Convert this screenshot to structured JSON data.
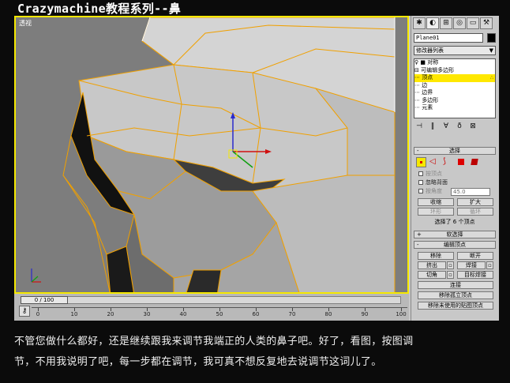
{
  "banner": {
    "title": "Crazymachine教程系列--鼻"
  },
  "viewport": {
    "label": "透视"
  },
  "timeline": {
    "slider_text": "0 / 100",
    "key_icon": "key-icon",
    "ticks": [
      "0",
      "10",
      "20",
      "30",
      "40",
      "50",
      "60",
      "70",
      "80",
      "90",
      "100"
    ]
  },
  "panel": {
    "tabs": [
      "create-icon",
      "modify-icon",
      "hierarchy-icon",
      "motion-icon",
      "display-icon",
      "utilities-icon"
    ],
    "object_name": "Plane01",
    "object_color": "#000000",
    "modifier_list": "修改器列表",
    "stack": {
      "items": [
        {
          "label": "♀ ■ 对称",
          "selected": false
        },
        {
          "label": "⊟ 可编辑多边形",
          "selected": false
        },
        {
          "label": "   ⋯ 顶点",
          "selected": true
        },
        {
          "label": "      ⋯ 边",
          "selected": false
        },
        {
          "label": "      ⋯ 边界",
          "selected": false
        },
        {
          "label": "      ⋯ 多边形",
          "selected": false
        },
        {
          "label": "      ⋯ 元素",
          "selected": false
        }
      ]
    },
    "selection": {
      "title": "选择",
      "by_vertex": "按顶点",
      "ignore_backfacing": "忽略背面",
      "by_angle": "按角度",
      "angle_value": "45.0",
      "shrink": "收缩",
      "grow": "扩大",
      "ring": "环形",
      "loop": "循环",
      "status": "选择了 6 个顶点"
    },
    "soft_selection": {
      "title": "软选择"
    },
    "edit_vertices": {
      "title": "编辑顶点",
      "remove": "移除",
      "break": "断开",
      "extrude": "挤出",
      "weld": "焊接",
      "chamfer": "切角",
      "target_weld": "目标焊接",
      "connect": "连接",
      "remove_isolated": "移除孤立顶点",
      "remove_unused_map": "移除未使用的贴图顶点"
    }
  },
  "caption": {
    "line1": "不管您做什么都好，还是继续跟我来调节我端正的人类的鼻子吧。好了，看图，按图调",
    "line2": "节，不用我说明了吧，每一步都在调节，我可真不想反复地去说调节这词儿了。"
  },
  "colors": {
    "accent_yellow": "#f5e800",
    "wire_orange": "#f0a000",
    "background": "#0b0b0b"
  }
}
